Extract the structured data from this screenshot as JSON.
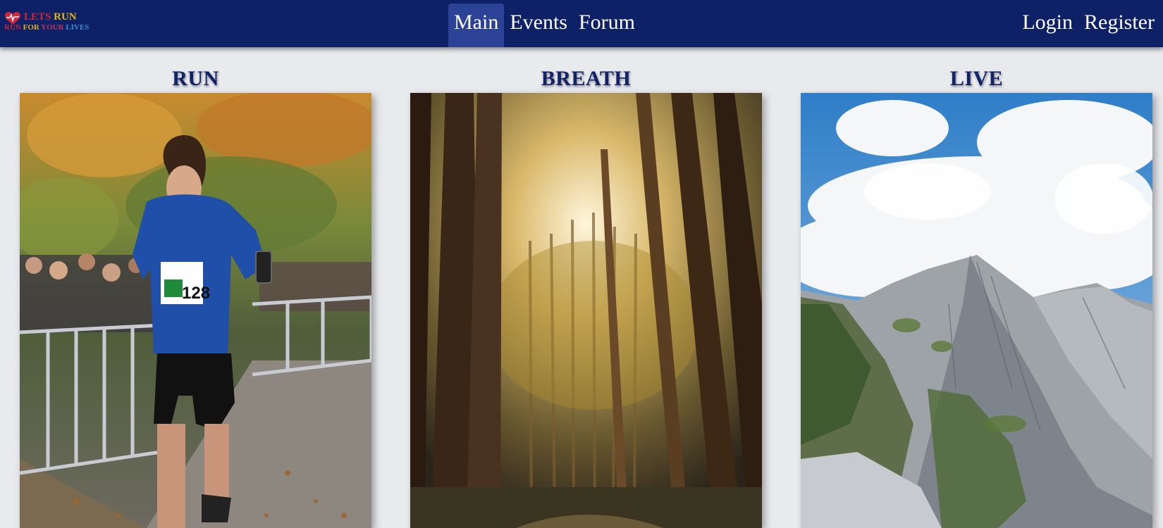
{
  "logo": {
    "line1_a": "LETS",
    "line1_b": "RUN",
    "line2_a": "RUN",
    "line2_b": "FOR",
    "line2_c": "YOUR",
    "line2_d": "LIVES"
  },
  "nav": {
    "main": "Main",
    "events": "Events",
    "forum": "Forum",
    "login": "Login",
    "register": "Register"
  },
  "cards": [
    {
      "title": "RUN",
      "image": "runner-photo",
      "bib_number": "128"
    },
    {
      "title": "BREATH",
      "image": "forest-photo"
    },
    {
      "title": "LIVE",
      "image": "mountain-photo"
    }
  ],
  "colors": {
    "navbar": "#0e2166",
    "nav_active": "#2b4296",
    "page_background": "#e9eaee",
    "title_text": "#112266"
  }
}
